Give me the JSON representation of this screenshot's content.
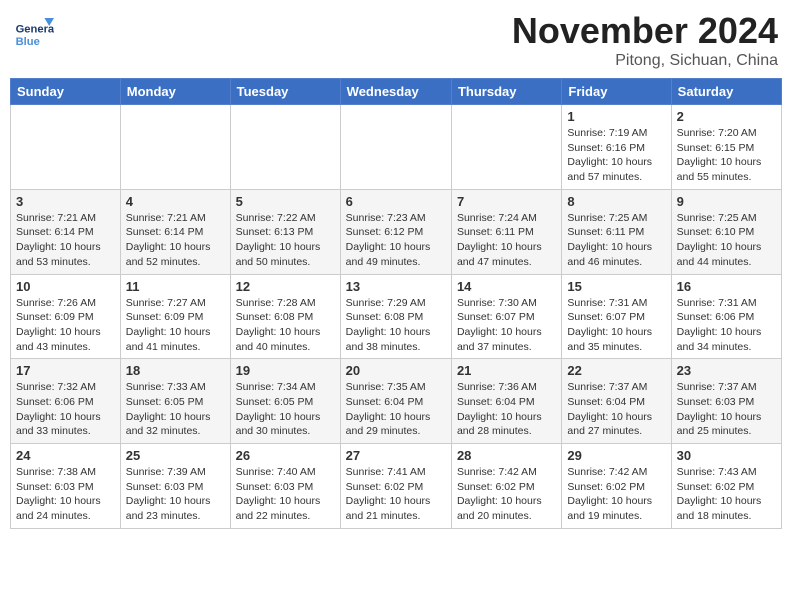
{
  "header": {
    "logo": {
      "line1": "General",
      "line2": "Blue"
    },
    "month_year": "November 2024",
    "location": "Pitong, Sichuan, China"
  },
  "days_of_week": [
    "Sunday",
    "Monday",
    "Tuesday",
    "Wednesday",
    "Thursday",
    "Friday",
    "Saturday"
  ],
  "weeks": [
    [
      {
        "day": "",
        "info": ""
      },
      {
        "day": "",
        "info": ""
      },
      {
        "day": "",
        "info": ""
      },
      {
        "day": "",
        "info": ""
      },
      {
        "day": "",
        "info": ""
      },
      {
        "day": "1",
        "info": "Sunrise: 7:19 AM\nSunset: 6:16 PM\nDaylight: 10 hours and 57 minutes."
      },
      {
        "day": "2",
        "info": "Sunrise: 7:20 AM\nSunset: 6:15 PM\nDaylight: 10 hours and 55 minutes."
      }
    ],
    [
      {
        "day": "3",
        "info": "Sunrise: 7:21 AM\nSunset: 6:14 PM\nDaylight: 10 hours and 53 minutes."
      },
      {
        "day": "4",
        "info": "Sunrise: 7:21 AM\nSunset: 6:14 PM\nDaylight: 10 hours and 52 minutes."
      },
      {
        "day": "5",
        "info": "Sunrise: 7:22 AM\nSunset: 6:13 PM\nDaylight: 10 hours and 50 minutes."
      },
      {
        "day": "6",
        "info": "Sunrise: 7:23 AM\nSunset: 6:12 PM\nDaylight: 10 hours and 49 minutes."
      },
      {
        "day": "7",
        "info": "Sunrise: 7:24 AM\nSunset: 6:11 PM\nDaylight: 10 hours and 47 minutes."
      },
      {
        "day": "8",
        "info": "Sunrise: 7:25 AM\nSunset: 6:11 PM\nDaylight: 10 hours and 46 minutes."
      },
      {
        "day": "9",
        "info": "Sunrise: 7:25 AM\nSunset: 6:10 PM\nDaylight: 10 hours and 44 minutes."
      }
    ],
    [
      {
        "day": "10",
        "info": "Sunrise: 7:26 AM\nSunset: 6:09 PM\nDaylight: 10 hours and 43 minutes."
      },
      {
        "day": "11",
        "info": "Sunrise: 7:27 AM\nSunset: 6:09 PM\nDaylight: 10 hours and 41 minutes."
      },
      {
        "day": "12",
        "info": "Sunrise: 7:28 AM\nSunset: 6:08 PM\nDaylight: 10 hours and 40 minutes."
      },
      {
        "day": "13",
        "info": "Sunrise: 7:29 AM\nSunset: 6:08 PM\nDaylight: 10 hours and 38 minutes."
      },
      {
        "day": "14",
        "info": "Sunrise: 7:30 AM\nSunset: 6:07 PM\nDaylight: 10 hours and 37 minutes."
      },
      {
        "day": "15",
        "info": "Sunrise: 7:31 AM\nSunset: 6:07 PM\nDaylight: 10 hours and 35 minutes."
      },
      {
        "day": "16",
        "info": "Sunrise: 7:31 AM\nSunset: 6:06 PM\nDaylight: 10 hours and 34 minutes."
      }
    ],
    [
      {
        "day": "17",
        "info": "Sunrise: 7:32 AM\nSunset: 6:06 PM\nDaylight: 10 hours and 33 minutes."
      },
      {
        "day": "18",
        "info": "Sunrise: 7:33 AM\nSunset: 6:05 PM\nDaylight: 10 hours and 32 minutes."
      },
      {
        "day": "19",
        "info": "Sunrise: 7:34 AM\nSunset: 6:05 PM\nDaylight: 10 hours and 30 minutes."
      },
      {
        "day": "20",
        "info": "Sunrise: 7:35 AM\nSunset: 6:04 PM\nDaylight: 10 hours and 29 minutes."
      },
      {
        "day": "21",
        "info": "Sunrise: 7:36 AM\nSunset: 6:04 PM\nDaylight: 10 hours and 28 minutes."
      },
      {
        "day": "22",
        "info": "Sunrise: 7:37 AM\nSunset: 6:04 PM\nDaylight: 10 hours and 27 minutes."
      },
      {
        "day": "23",
        "info": "Sunrise: 7:37 AM\nSunset: 6:03 PM\nDaylight: 10 hours and 25 minutes."
      }
    ],
    [
      {
        "day": "24",
        "info": "Sunrise: 7:38 AM\nSunset: 6:03 PM\nDaylight: 10 hours and 24 minutes."
      },
      {
        "day": "25",
        "info": "Sunrise: 7:39 AM\nSunset: 6:03 PM\nDaylight: 10 hours and 23 minutes."
      },
      {
        "day": "26",
        "info": "Sunrise: 7:40 AM\nSunset: 6:03 PM\nDaylight: 10 hours and 22 minutes."
      },
      {
        "day": "27",
        "info": "Sunrise: 7:41 AM\nSunset: 6:02 PM\nDaylight: 10 hours and 21 minutes."
      },
      {
        "day": "28",
        "info": "Sunrise: 7:42 AM\nSunset: 6:02 PM\nDaylight: 10 hours and 20 minutes."
      },
      {
        "day": "29",
        "info": "Sunrise: 7:42 AM\nSunset: 6:02 PM\nDaylight: 10 hours and 19 minutes."
      },
      {
        "day": "30",
        "info": "Sunrise: 7:43 AM\nSunset: 6:02 PM\nDaylight: 10 hours and 18 minutes."
      }
    ]
  ]
}
